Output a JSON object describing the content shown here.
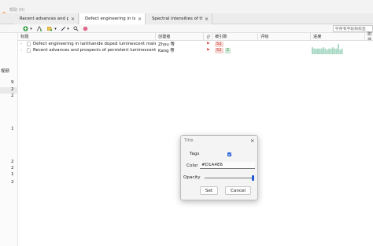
{
  "menubar": {
    "help_label": "帮助 (H)"
  },
  "tabs": [
    {
      "label": "Recent advances and pro...",
      "close": "×"
    },
    {
      "label": "Defect engineering in lan...",
      "close": "×"
    },
    {
      "label": "Spectral intensities of the...",
      "close": "×"
    }
  ],
  "search": {
    "placeholder": "所有字段和标签"
  },
  "left_pane": {
    "label": "视频",
    "numbers": [
      "9",
      "2",
      "2",
      "1",
      "2",
      "2",
      "1",
      "2"
    ]
  },
  "columns": [
    "标题",
    "创建者",
    "",
    "被引数",
    "评级",
    "进度",
    "附件"
  ],
  "rows": [
    {
      "title": "Defect engineering in lanthanide doped luminescent materials",
      "creator": "Zhou 等",
      "tags": [
        "52"
      ]
    },
    {
      "title": "Recent advances and prospects of persistent luminescent mat...",
      "creator": "Kang 等",
      "tags": [
        "52",
        "2"
      ]
    }
  ],
  "progress_levels": [
    0.55,
    0.45,
    0.45,
    0.45,
    0.45,
    0.45,
    0.55,
    0.45,
    0.35,
    0.45,
    0.45,
    0.55,
    0.45,
    0.45,
    0.8,
    0.35,
    0.45
  ],
  "colors": {
    "accent": "#1d5bd8",
    "progress": "#a8d8c4",
    "tag_red_bg": "#f6d5d3",
    "tag_red_text": "#c0392b",
    "tag_green_bg": "#cfe9d6",
    "tag_green_text": "#2e8b4e"
  },
  "dialog": {
    "title": "Title",
    "close": "×",
    "tags_label": "Tags",
    "tags_checked": true,
    "color_label": "Color",
    "color_value": "#D1A4E6",
    "opacity_label": "Opacity",
    "opacity": 1.0,
    "set_label": "Set",
    "cancel_label": "Cancel"
  }
}
